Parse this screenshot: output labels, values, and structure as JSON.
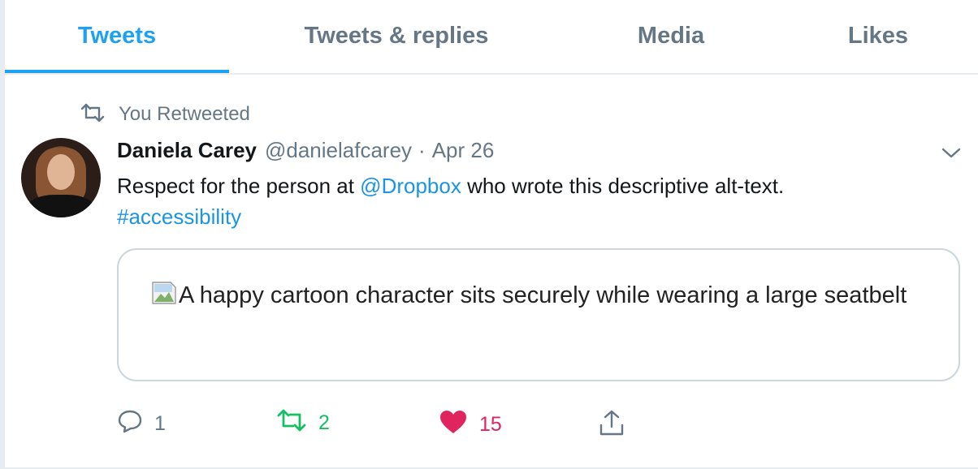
{
  "tabs": [
    {
      "label": "Tweets",
      "active": true
    },
    {
      "label": "Tweets & replies",
      "active": false
    },
    {
      "label": "Media",
      "active": false
    },
    {
      "label": "Likes",
      "active": false
    }
  ],
  "tweet": {
    "retweet_context": "You Retweeted",
    "author_name": "Daniela Carey",
    "author_handle": "@danielafcarey",
    "separator": "·",
    "date": "Apr 26",
    "text_part1": "Respect for the person at ",
    "mention": "@Dropbox",
    "text_part2": " who wrote this descriptive alt-text.",
    "hashtag": "#accessibility",
    "image_alt_text": "A happy cartoon character sits securely while wearing a large seatbelt",
    "reply_count": "1",
    "retweet_count": "2",
    "like_count": "15"
  },
  "colors": {
    "accent": "#1da1f2",
    "muted": "#657786",
    "retweeted": "#17bf63",
    "liked": "#e0245e",
    "border": "#ccd6dd"
  },
  "icons": [
    "retweet-icon",
    "chevron-down-icon",
    "broken-image-icon",
    "reply-icon",
    "retweet-icon",
    "heart-icon",
    "share-icon"
  ]
}
